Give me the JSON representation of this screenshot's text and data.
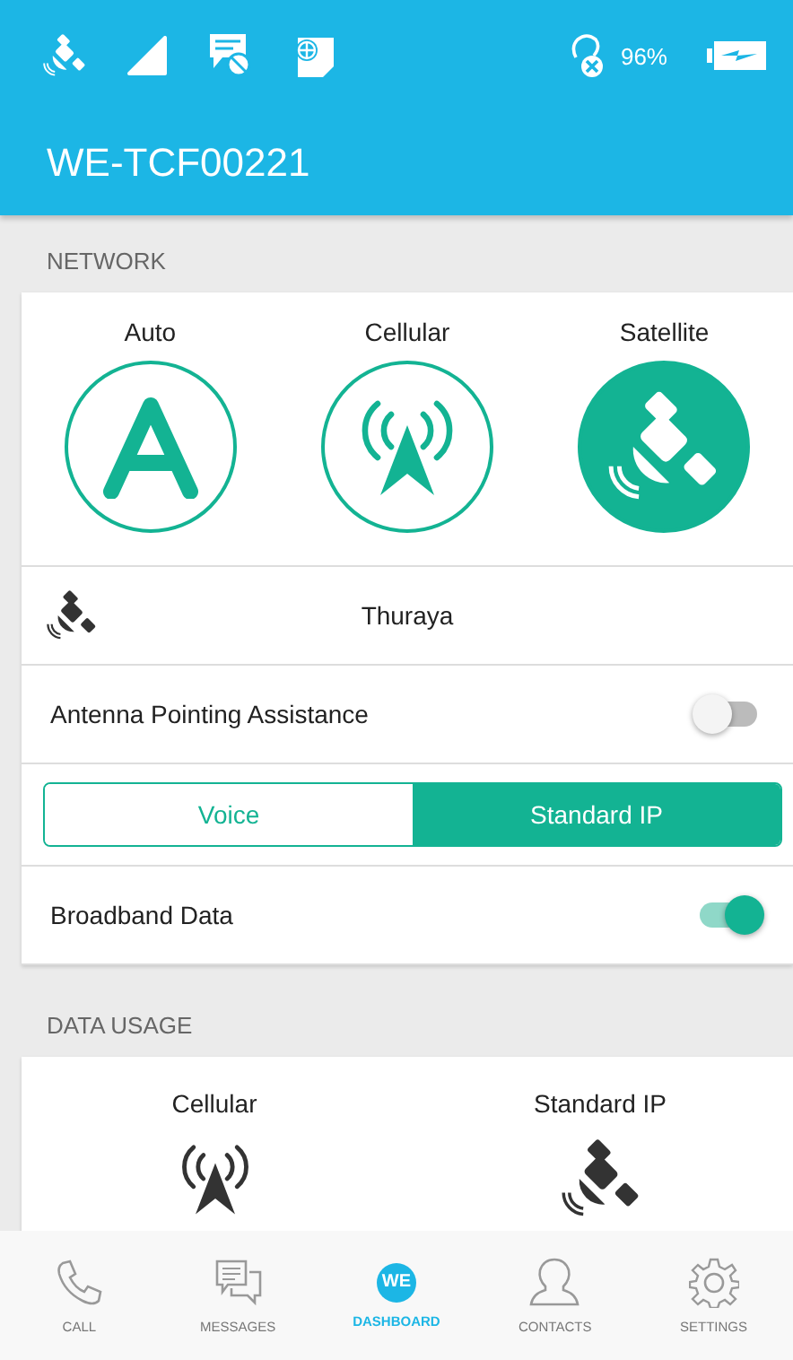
{
  "status_bar": {
    "battery_percent": "96%"
  },
  "header": {
    "title": "WE-TCF00221"
  },
  "network": {
    "section_label": "NETWORK",
    "modes": [
      {
        "label": "Auto",
        "kind": "auto",
        "selected": false
      },
      {
        "label": "Cellular",
        "kind": "cellular",
        "selected": false
      },
      {
        "label": "Satellite",
        "kind": "satellite",
        "selected": true
      }
    ],
    "provider": "Thuraya",
    "antenna_pointing": {
      "label": "Antenna Pointing Assistance",
      "on": false
    },
    "service_options": [
      {
        "label": "Voice",
        "selected": false
      },
      {
        "label": "Standard IP",
        "selected": true
      }
    ],
    "broadband": {
      "label": "Broadband Data",
      "on": true
    }
  },
  "data_usage": {
    "section_label": "DATA USAGE",
    "items": [
      {
        "label": "Cellular",
        "kind": "cellular"
      },
      {
        "label": "Standard IP",
        "kind": "satellite"
      }
    ]
  },
  "nav": {
    "logo_text": "WE",
    "items": [
      {
        "label": "CALL",
        "kind": "call",
        "selected": false
      },
      {
        "label": "MESSAGES",
        "kind": "messages",
        "selected": false
      },
      {
        "label": "DASHBOARD",
        "kind": "dashboard",
        "selected": true
      },
      {
        "label": "CONTACTS",
        "kind": "contacts",
        "selected": false
      },
      {
        "label": "SETTINGS",
        "kind": "settings",
        "selected": false
      }
    ]
  }
}
